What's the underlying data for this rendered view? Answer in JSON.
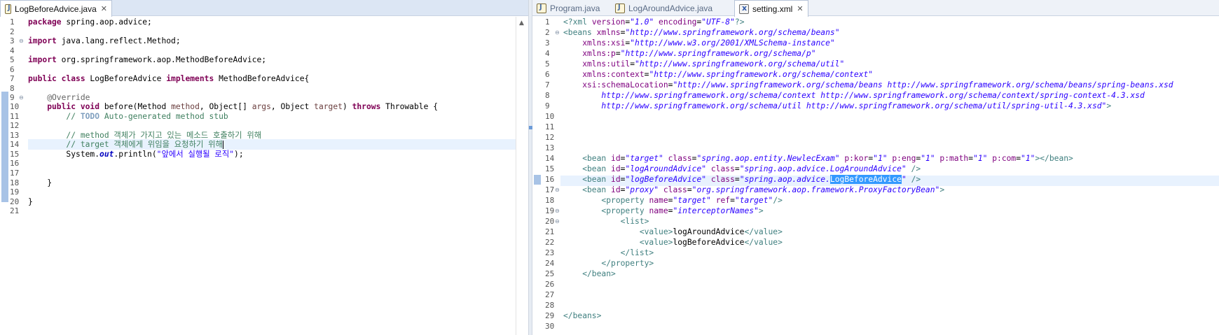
{
  "left": {
    "tab": {
      "label": "LogBeforeAdvice.java"
    },
    "lines": [
      "1",
      "2",
      "3",
      "4",
      "5",
      "6",
      "7",
      "8",
      "9",
      "10",
      "11",
      "12",
      "13",
      "14",
      "15",
      "16",
      "17",
      "18",
      "19",
      "20",
      "21"
    ],
    "code": {
      "l1_kw": "package",
      "l1_rest": " spring.aop.advice;",
      "l3_kw": "import",
      "l3_rest": " java.lang.reflect.Method;",
      "l5_kw": "import",
      "l5_rest": " org.springframework.aop.MethodBeforeAdvice;",
      "l7_kw1": "public class",
      "l7_mid": " LogBeforeAdvice ",
      "l7_kw2": "implements",
      "l7_rest": " MethodBeforeAdvice{",
      "l9_ann": "    @Override",
      "l10_kw1": "    public void",
      "l10_a": " before(Method ",
      "l10_p1": "method",
      "l10_b": ", Object[] ",
      "l10_p2": "args",
      "l10_c": ", Object ",
      "l10_p3": "target",
      "l10_d": ") ",
      "l10_kw2": "throws",
      "l10_e": " Throwable {",
      "l11_cm": "        // ",
      "l11_todo": "TODO",
      "l11_cm2": " Auto-generated method stub",
      "l13_cm": "        // method 객체가 가지고 있는 메소드 호출하기 위해",
      "l14_cm": "        // target 객체에게 위임을 요청하기 위해",
      "l15_a": "        System.",
      "l15_fld": "out",
      "l15_b": ".println(",
      "l15_str": "\"앞에서 실행될 로직\"",
      "l15_c": ");",
      "l18": "    }",
      "l20": "}"
    }
  },
  "right": {
    "tabs": [
      {
        "label": "Program.java"
      },
      {
        "label": "LogAroundAdvice.java"
      },
      {
        "label": "setting.xml"
      }
    ],
    "lines": [
      "1",
      "2",
      "3",
      "4",
      "5",
      "6",
      "7",
      "8",
      "9",
      "10",
      "11",
      "12",
      "13",
      "14",
      "15",
      "16",
      "17",
      "18",
      "19",
      "20",
      "21",
      "22",
      "23",
      "24",
      "25",
      "26",
      "27",
      "28",
      "29",
      "30"
    ],
    "xml": {
      "l1_a": "<?xml ",
      "l1_b": "version",
      "l1_c": "=",
      "l1_d": "\"1.0\"",
      "l1_e": " encoding",
      "l1_f": "=",
      "l1_g": "\"UTF-8\"",
      "l1_h": "?>",
      "l2_t": "<beans ",
      "l2_a": "xmlns",
      "l2_v": "\"http://www.springframework.org/schema/beans\"",
      "l3_a": "    xmlns:xsi",
      "l3_v": "\"http://www.w3.org/2001/XMLSchema-instance\"",
      "l4_a": "    xmlns:p",
      "l4_v": "\"http://www.springframework.org/schema/p\"",
      "l5_a": "    xmlns:util",
      "l5_v": "\"http://www.springframework.org/schema/util\"",
      "l6_a": "    xmlns:context",
      "l6_v": "\"http://www.springframework.org/schema/context\"",
      "l7_a": "    xsi:schemaLocation",
      "l7_v": "\"http://www.springframework.org/schema/beans http://www.springframework.org/schema/beans/spring-beans.xsd",
      "l8_v": "        http://www.springframework.org/schema/context http://www.springframework.org/schema/context/spring-context-4.3.xsd",
      "l9_v": "        http://www.springframework.org/schema/util http://www.springframework.org/schema/util/spring-util-4.3.xsd\"",
      "l9_t": ">",
      "l14_t1": "    <bean ",
      "l14_a1": "id",
      "l14_v1": "\"target\"",
      "l14_a2": " class",
      "l14_v2": "\"spring.aop.entity.NewlecExam\"",
      "l14_a3": " p:kor",
      "l14_v3": "\"1\"",
      "l14_a4": " p:eng",
      "l14_v4": "\"1\"",
      "l14_a5": " p:math",
      "l14_v5": "\"1\"",
      "l14_a6": " p:com",
      "l14_v6": "\"1\"",
      "l14_t2": "></bean>",
      "l15_t1": "    <bean ",
      "l15_a1": "id",
      "l15_v1": "\"logAroundAdvice\"",
      "l15_a2": " class",
      "l15_v2": "\"spring.aop.advice.LogAroundAdvice\"",
      "l15_t2": " />",
      "l16_t1": "    <bean ",
      "l16_a1": "id",
      "l16_v1": "\"logBeforeAdvice\"",
      "l16_a2": " class",
      "l16_v2a": "\"spring.aop.advice.",
      "l16_sel": "LogBeforeAdvice",
      "l16_v2b": "\"",
      "l16_t2": " />",
      "l17_t1": "    <bean ",
      "l17_a1": "id",
      "l17_v1": "\"proxy\"",
      "l17_a2": " class",
      "l17_v2": "\"org.springframework.aop.framework.ProxyFactoryBean\"",
      "l17_t2": ">",
      "l18_t1": "        <property ",
      "l18_a1": "name",
      "l18_v1": "\"target\"",
      "l18_a2": " ref",
      "l18_v2": "\"target\"",
      "l18_t2": "/>",
      "l19_t1": "        <property ",
      "l19_a1": "name",
      "l19_v1": "\"interceptorNames\"",
      "l19_t2": ">",
      "l20_t": "            <list>",
      "l21_t1": "                <value>",
      "l21_x": "logAroundAdvice",
      "l21_t2": "</value>",
      "l22_t1": "                <value>",
      "l22_x": "logBeforeAdvice",
      "l22_t2": "</value>",
      "l23_t": "            </list>",
      "l24_t": "        </property>",
      "l25_t": "    </bean>",
      "l29_t": "</beans>"
    }
  }
}
